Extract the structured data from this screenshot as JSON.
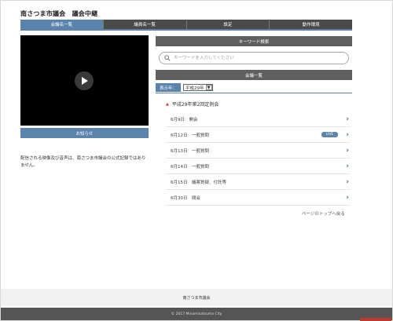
{
  "site": {
    "title": "南さつま市議会　議会中継"
  },
  "nav": {
    "items": [
      {
        "label": "会議名一覧",
        "active": true
      },
      {
        "label": "議員名一覧",
        "active": false
      },
      {
        "label": "設定",
        "active": false
      },
      {
        "label": "動作環境",
        "active": false
      }
    ]
  },
  "video": {
    "play_icon": "play-icon"
  },
  "notice": {
    "title": "お知らせ",
    "text": "配信される映像及び音声は、南さつま市議会の公式記録ではありません。"
  },
  "keyword": {
    "header": "キーワード検索",
    "placeholder": "キーワードを入力してください"
  },
  "meetings": {
    "header": "会議一覧",
    "year_label": "表示年：",
    "year_value": "平成29年",
    "session_title": "平成29年第2回定例会",
    "items": [
      {
        "label": "6月9日　開会",
        "live": ""
      },
      {
        "label": "6月12日　一般質問",
        "live": "LIVE"
      },
      {
        "label": "6月13日　一般質問",
        "live": ""
      },
      {
        "label": "6月14日　一般質問",
        "live": ""
      },
      {
        "label": "6月15日　議案質疑、付託等",
        "live": ""
      },
      {
        "label": "6月30日　閉会",
        "live": ""
      }
    ]
  },
  "page_top": "ページのトップへ戻る",
  "footer": {
    "name": "南さつま市議会",
    "copyright": "© 2017 Minamisatsuma City"
  },
  "colors": {
    "accent": "#5b84ad",
    "dark": "#4a4a4a",
    "live_badge": "#5b84ad"
  }
}
